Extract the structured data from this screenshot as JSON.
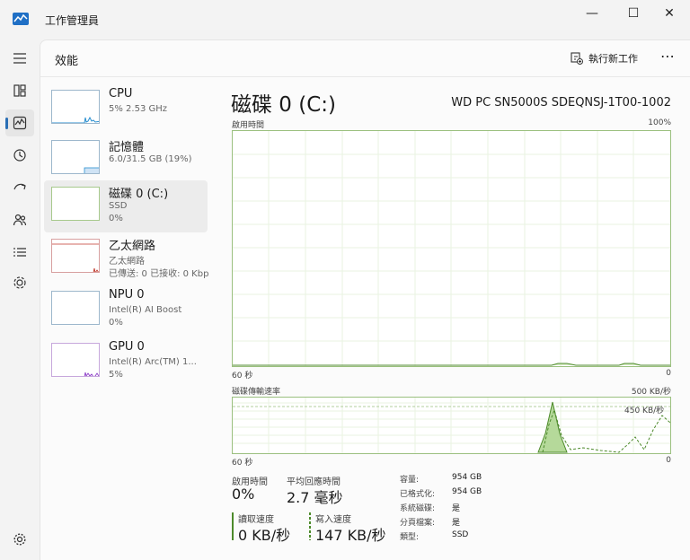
{
  "window": {
    "title": "工作管理員",
    "controls": {
      "minimize": "—",
      "maximize": "☐",
      "close": "✕"
    }
  },
  "nav": {
    "items": [
      {
        "name": "menu-icon",
        "glyph": "☰"
      },
      {
        "name": "processes-icon",
        "glyph": "▦"
      },
      {
        "name": "performance-icon",
        "glyph": "⌇",
        "active": true
      },
      {
        "name": "app-history-icon",
        "glyph": "↺"
      },
      {
        "name": "startup-apps-icon",
        "glyph": "⟲"
      },
      {
        "name": "users-icon",
        "glyph": "⚇"
      },
      {
        "name": "details-icon",
        "glyph": "≡"
      },
      {
        "name": "services-icon",
        "glyph": "✲"
      }
    ],
    "settings_glyph": "⚙"
  },
  "header": {
    "title": "效能",
    "run_task_label": "執行新工作",
    "more_label": "⋯"
  },
  "sidebar": {
    "items": [
      {
        "name": "CPU",
        "line1": "5%  2.53 GHz",
        "line2": ""
      },
      {
        "name": "記憶體",
        "line1": "6.0/31.5 GB (19%)",
        "line2": ""
      },
      {
        "name": "磁碟 0 (C:)",
        "line1": "SSD",
        "line2": "0%"
      },
      {
        "name": "乙太網路",
        "line1": "乙太網路",
        "line2": "已傳送: 0 已接收: 0 Kbps"
      },
      {
        "name": "NPU 0",
        "line1": "Intel(R) AI Boost",
        "line2": "0%"
      },
      {
        "name": "GPU 0",
        "line1": "Intel(R) Arc(TM) 1...",
        "line2": "5%"
      }
    ]
  },
  "disk": {
    "title": "磁碟 0 (C:)",
    "model": "WD PC SN5000S SDEQNSJ-1T00-1002",
    "active_time_chart": {
      "label": "啟用時間",
      "max": "100%",
      "time_left": "60 秒",
      "time_right": "0"
    },
    "transfer_chart": {
      "label": "磁碟傳輸速率",
      "max": "500 KB/秒",
      "inner_label": "450 KB/秒",
      "time_left": "60 秒",
      "time_right": "0"
    },
    "stats": {
      "active_time_label": "啟用時間",
      "active_time_value": "0%",
      "avg_response_label": "平均回應時間",
      "avg_response_value": "2.7 毫秒",
      "read_label": "讀取速度",
      "read_value": "0 KB/秒",
      "write_label": "寫入速度",
      "write_value": "147 KB/秒"
    },
    "properties": [
      {
        "key": "容量:",
        "value": "954 GB"
      },
      {
        "key": "已格式化:",
        "value": "954 GB"
      },
      {
        "key": "系統磁碟:",
        "value": "是"
      },
      {
        "key": "分頁檔案:",
        "value": "是"
      },
      {
        "key": "類型:",
        "value": "SSD"
      }
    ]
  },
  "colors": {
    "disk_accent": "#4d8a2b",
    "disk_fill": "#d7ecc4",
    "cpu_line": "#2a8fd0",
    "net_line": "#c0392b",
    "gpu_line": "#8c3cc8"
  }
}
